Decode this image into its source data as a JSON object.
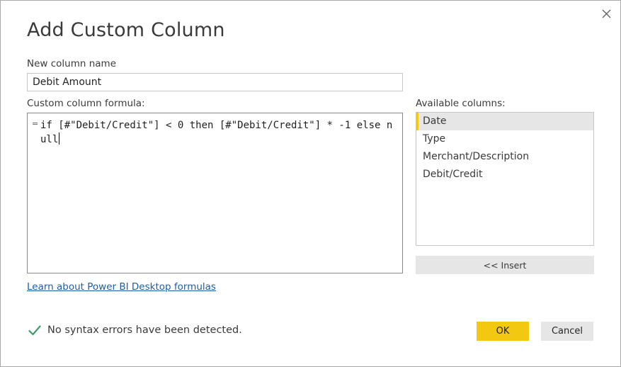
{
  "dialog": {
    "title": "Add Custom Column",
    "close_icon": "close-icon"
  },
  "name_field": {
    "label": "New column name",
    "value": "Debit Amount"
  },
  "formula": {
    "label": "Custom column formula:",
    "prefix": "=",
    "text": "if [#\"Debit/Credit\"] < 0 then [#\"Debit/Credit\"] * -1 else null"
  },
  "available_columns": {
    "label": "Available columns:",
    "items": [
      {
        "label": "Date",
        "selected": true
      },
      {
        "label": "Type",
        "selected": false
      },
      {
        "label": "Merchant/Description",
        "selected": false
      },
      {
        "label": "Debit/Credit",
        "selected": false
      }
    ],
    "insert_label": "<< Insert"
  },
  "help_link": "Learn about Power BI Desktop formulas",
  "status": {
    "icon": "checkmark-icon",
    "text": "No syntax errors have been detected.",
    "color": "#3a9c6b"
  },
  "buttons": {
    "ok": "OK",
    "cancel": "Cancel"
  },
  "colors": {
    "accent": "#f2c811",
    "link": "#1a5fa8",
    "selection": "#e6e6e6"
  }
}
